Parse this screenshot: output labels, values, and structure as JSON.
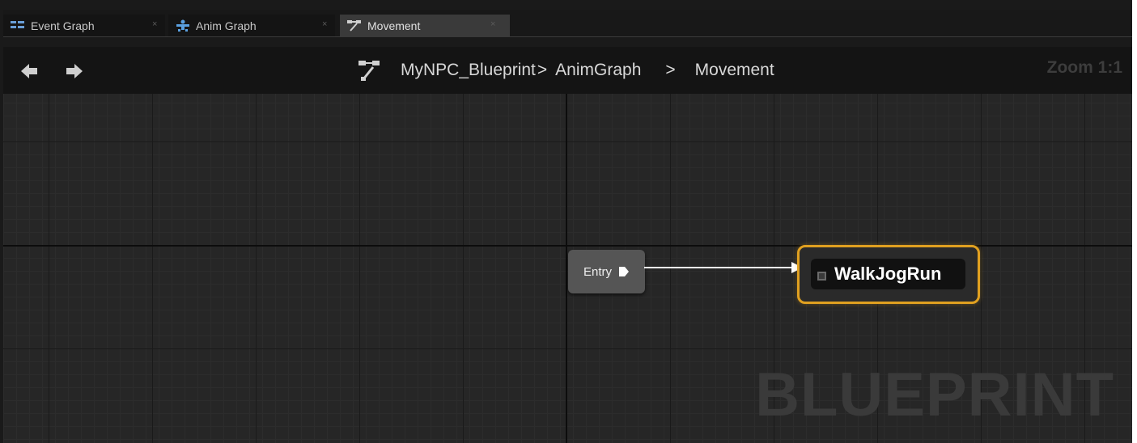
{
  "tabs": [
    {
      "label": "Event Graph",
      "icon": "event-graph-icon",
      "active": false
    },
    {
      "label": "Anim Graph",
      "icon": "anim-graph-icon",
      "active": false
    },
    {
      "label": "Movement",
      "icon": "state-machine-icon",
      "active": true
    }
  ],
  "tab_close_glyph": "×",
  "breadcrumb": {
    "icon": "state-machine-icon",
    "items": [
      "MyNPC_Blueprint",
      "AnimGraph",
      "Movement"
    ],
    "separator": ">"
  },
  "navigation": {
    "back_icon": "arrow-left-icon",
    "forward_icon": "arrow-right-icon"
  },
  "zoom_label": "Zoom 1:1",
  "graph": {
    "entry_node": {
      "label": "Entry"
    },
    "state_node": {
      "label": "WalkJogRun"
    },
    "watermark": "BLUEPRINT"
  },
  "colors": {
    "state_border": "#e0a020",
    "canvas_bg": "#262626",
    "wire": "#ffffff",
    "event_graph_icon": "#6a9fd8",
    "anim_graph_icon": "#5aa0e0",
    "state_machine_icon": "#cfcfcf"
  }
}
